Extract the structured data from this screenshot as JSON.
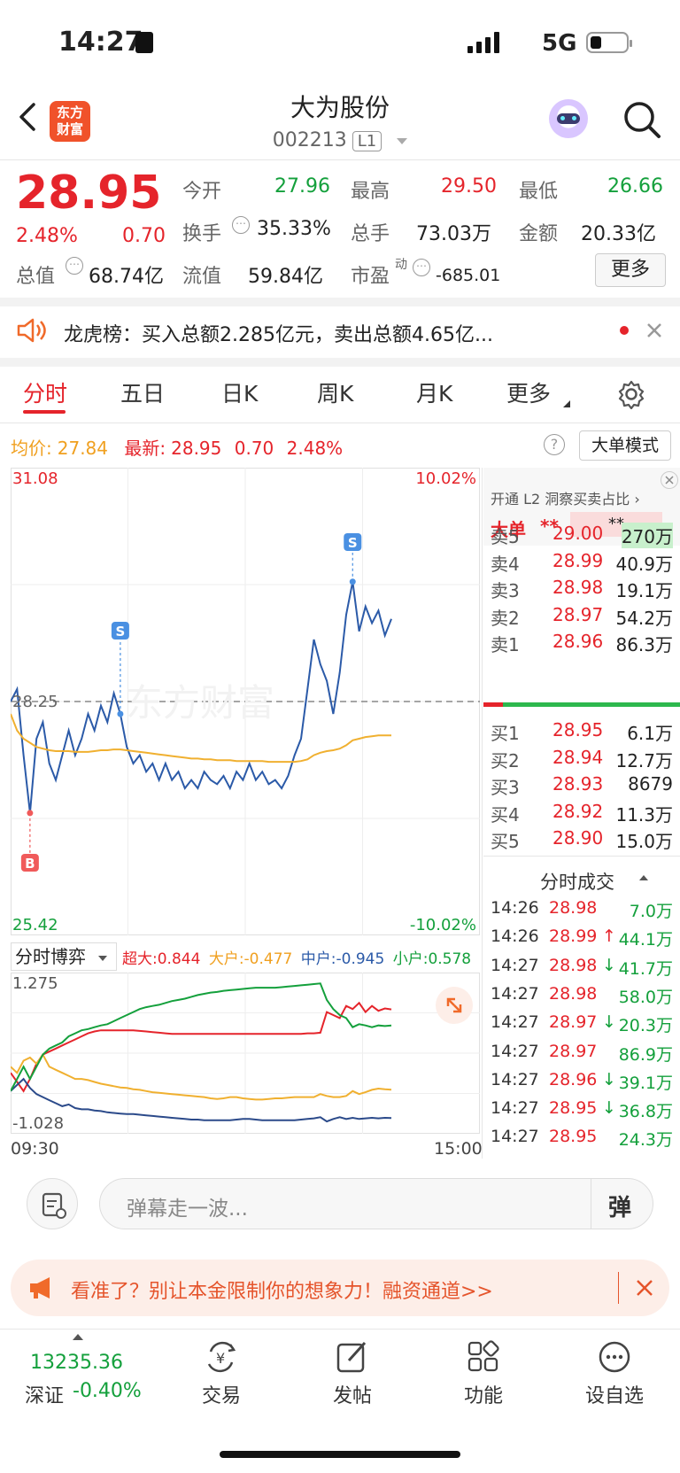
{
  "status_bar": {
    "time": "14:27",
    "network": "5G"
  },
  "header": {
    "title": "大为股份",
    "code": "002213",
    "level_badge": "L1",
    "logo_text_1": "东方",
    "logo_text_2": "财富"
  },
  "quote": {
    "price": "28.95",
    "change_pct": "2.48%",
    "change": "0.70",
    "open_label": "今开",
    "open": "27.96",
    "high_label": "最高",
    "high": "29.50",
    "low_label": "最低",
    "low": "26.66",
    "turnover_label": "换手",
    "turnover": "35.33%",
    "volume_label": "总手",
    "volume": "73.03万",
    "amount_label": "金额",
    "amount": "20.33亿",
    "mktcap_label": "总值",
    "mktcap": "68.74亿",
    "float_label": "流值",
    "float": "59.84亿",
    "pe_label": "市盈",
    "pe_sup": "动",
    "pe": "-685.01",
    "more_label": "更多"
  },
  "news": {
    "text": "龙虎榜：买入总额2.285亿元，卖出总额4.65亿..."
  },
  "tabs": [
    "分时",
    "五日",
    "日K",
    "周K",
    "月K",
    "更多"
  ],
  "chart_header": {
    "avg_label": "均价:",
    "avg": "27.84",
    "latest_label": "最新:",
    "latest": "28.95",
    "chg": "0.70",
    "chg_pct": "2.48%",
    "mode_button": "大单模式"
  },
  "chart_data": [
    {
      "type": "line",
      "name": "分时",
      "ylim": [
        25.42,
        31.08
      ],
      "y_tick_labels": [
        "31.08",
        "28.25",
        "25.42"
      ],
      "pct_tick_labels": [
        "10.02%",
        "-10.02%"
      ],
      "x_tick_labels": [
        "09:30",
        "15:00"
      ],
      "prev_close": 28.25,
      "series": [
        {
          "name": "price",
          "color": "#2b5aa8",
          "values": [
            28.25,
            28.4,
            27.6,
            26.9,
            27.8,
            28.0,
            27.5,
            27.3,
            27.6,
            27.9,
            27.6,
            27.8,
            28.1,
            27.9,
            28.2,
            28.0,
            28.35,
            28.1,
            27.7,
            27.5,
            27.6,
            27.4,
            27.5,
            27.3,
            27.5,
            27.3,
            27.4,
            27.2,
            27.3,
            27.2,
            27.4,
            27.3,
            27.25,
            27.35,
            27.2,
            27.4,
            27.3,
            27.5,
            27.3,
            27.4,
            27.25,
            27.3,
            27.2,
            27.35,
            27.6,
            27.8,
            28.4,
            29.0,
            28.7,
            28.5,
            28.1,
            28.6,
            29.3,
            29.7,
            29.1,
            29.4,
            29.2,
            29.35,
            29.05,
            29.25
          ]
        },
        {
          "name": "avg",
          "color": "#f0b030",
          "values": [
            28.1,
            27.9,
            27.8,
            27.75,
            27.7,
            27.68,
            27.66,
            27.65,
            27.65,
            27.65,
            27.64,
            27.64,
            27.64,
            27.65,
            27.66,
            27.66,
            27.67,
            27.67,
            27.66,
            27.65,
            27.64,
            27.63,
            27.62,
            27.61,
            27.6,
            27.59,
            27.58,
            27.57,
            27.56,
            27.56,
            27.55,
            27.55,
            27.54,
            27.54,
            27.54,
            27.53,
            27.53,
            27.53,
            27.53,
            27.53,
            27.52,
            27.52,
            27.52,
            27.52,
            27.52,
            27.53,
            27.55,
            27.6,
            27.63,
            27.65,
            27.66,
            27.68,
            27.72,
            27.78,
            27.8,
            27.82,
            27.83,
            27.84,
            27.84,
            27.84
          ]
        }
      ],
      "markers": [
        "B",
        "S",
        "S"
      ],
      "watermark": "东方财富"
    },
    {
      "type": "line",
      "name": "分时博弈",
      "ylim": [
        -1.028,
        1.275
      ],
      "y_tick_labels": [
        "1.275",
        "-1.028"
      ],
      "series": [
        {
          "name": "超大",
          "value_label": "0.844",
          "color": "#e5242b",
          "values": [
            -0.2,
            -0.35,
            -0.5,
            -0.3,
            -0.05,
            0.1,
            0.15,
            0.2,
            0.25,
            0.3,
            0.35,
            0.4,
            0.45,
            0.48,
            0.5,
            0.5,
            0.5,
            0.5,
            0.5,
            0.5,
            0.49,
            0.48,
            0.47,
            0.46,
            0.45,
            0.44,
            0.44,
            0.44,
            0.44,
            0.44,
            0.44,
            0.44,
            0.44,
            0.44,
            0.44,
            0.44,
            0.44,
            0.44,
            0.44,
            0.44,
            0.44,
            0.44,
            0.44,
            0.44,
            0.44,
            0.44,
            0.45,
            0.45,
            0.46,
            0.8,
            0.75,
            0.7,
            0.9,
            0.85,
            0.95,
            0.8,
            0.9,
            0.82,
            0.86,
            0.844
          ]
        },
        {
          "name": "大户",
          "value_label": "-0.477",
          "color": "#f0b030",
          "values": [
            -0.1,
            -0.2,
            0.0,
            0.05,
            -0.05,
            0.1,
            -0.1,
            -0.15,
            -0.2,
            -0.25,
            -0.3,
            -0.3,
            -0.32,
            -0.35,
            -0.38,
            -0.4,
            -0.42,
            -0.44,
            -0.45,
            -0.47,
            -0.48,
            -0.5,
            -0.52,
            -0.53,
            -0.54,
            -0.55,
            -0.56,
            -0.57,
            -0.58,
            -0.59,
            -0.6,
            -0.62,
            -0.63,
            -0.62,
            -0.6,
            -0.6,
            -0.62,
            -0.63,
            -0.64,
            -0.64,
            -0.63,
            -0.62,
            -0.62,
            -0.61,
            -0.6,
            -0.6,
            -0.6,
            -0.6,
            -0.55,
            -0.58,
            -0.6,
            -0.6,
            -0.58,
            -0.5,
            -0.55,
            -0.52,
            -0.48,
            -0.46,
            -0.47,
            -0.477
          ]
        },
        {
          "name": "中户",
          "value_label": "-0.945",
          "color": "#2b4a8a",
          "values": [
            -0.5,
            -0.4,
            -0.3,
            -0.45,
            -0.55,
            -0.6,
            -0.65,
            -0.7,
            -0.75,
            -0.72,
            -0.78,
            -0.8,
            -0.8,
            -0.82,
            -0.83,
            -0.85,
            -0.86,
            -0.87,
            -0.88,
            -0.88,
            -0.89,
            -0.9,
            -0.91,
            -0.92,
            -0.93,
            -0.94,
            -0.95,
            -0.96,
            -0.97,
            -0.97,
            -0.98,
            -0.98,
            -0.98,
            -0.98,
            -0.98,
            -0.97,
            -0.96,
            -0.96,
            -0.97,
            -0.98,
            -0.98,
            -0.98,
            -0.98,
            -0.98,
            -0.98,
            -0.97,
            -0.96,
            -0.95,
            -0.93,
            -1.0,
            -0.96,
            -0.93,
            -0.96,
            -0.94,
            -0.96,
            -0.95,
            -0.94,
            -0.95,
            -0.94,
            -0.945
          ]
        },
        {
          "name": "小户",
          "value_label": "0.578",
          "color": "#14a03c",
          "values": [
            -0.5,
            -0.3,
            -0.1,
            -0.3,
            -0.1,
            0.1,
            0.2,
            0.25,
            0.3,
            0.4,
            0.45,
            0.5,
            0.52,
            0.55,
            0.58,
            0.6,
            0.65,
            0.7,
            0.75,
            0.8,
            0.85,
            0.88,
            0.9,
            0.92,
            0.95,
            0.98,
            1.0,
            1.02,
            1.05,
            1.08,
            1.1,
            1.12,
            1.13,
            1.15,
            1.16,
            1.17,
            1.18,
            1.19,
            1.2,
            1.2,
            1.2,
            1.2,
            1.21,
            1.22,
            1.23,
            1.24,
            1.25,
            1.26,
            1.27,
            1.0,
            0.85,
            0.75,
            0.7,
            0.55,
            0.6,
            0.58,
            0.55,
            0.58,
            0.57,
            0.578
          ]
        }
      ]
    }
  ],
  "game_header": {
    "title": "分时博弈"
  },
  "order_book": {
    "promo": "开通 L2 洞察买卖占比",
    "big_label": "大单",
    "big_val1": "**",
    "big_val2": "**",
    "asks": [
      {
        "label": "卖5",
        "price": "29.00",
        "vol": "270万"
      },
      {
        "label": "卖4",
        "price": "28.99",
        "vol": "40.9万"
      },
      {
        "label": "卖3",
        "price": "28.98",
        "vol": "19.1万"
      },
      {
        "label": "卖2",
        "price": "28.97",
        "vol": "54.2万"
      },
      {
        "label": "卖1",
        "price": "28.96",
        "vol": "86.3万"
      }
    ],
    "bids": [
      {
        "label": "买1",
        "price": "28.95",
        "vol": "6.1万"
      },
      {
        "label": "买2",
        "price": "28.94",
        "vol": "12.7万"
      },
      {
        "label": "买3",
        "price": "28.93",
        "vol": "8679"
      },
      {
        "label": "买4",
        "price": "28.92",
        "vol": "11.3万"
      },
      {
        "label": "买5",
        "price": "28.90",
        "vol": "15.0万"
      }
    ],
    "trades_title": "分时成交",
    "trades": [
      {
        "time": "14:26",
        "price": "28.98",
        "vol": "7.0万",
        "dir": ""
      },
      {
        "time": "14:26",
        "price": "28.99",
        "vol": "44.1万",
        "dir": "↑"
      },
      {
        "time": "14:27",
        "price": "28.98",
        "vol": "41.7万",
        "dir": "↓"
      },
      {
        "time": "14:27",
        "price": "28.98",
        "vol": "58.0万",
        "dir": ""
      },
      {
        "time": "14:27",
        "price": "28.97",
        "vol": "20.3万",
        "dir": "↓"
      },
      {
        "time": "14:27",
        "price": "28.97",
        "vol": "86.9万",
        "dir": ""
      },
      {
        "time": "14:27",
        "price": "28.96",
        "vol": "39.1万",
        "dir": "↓"
      },
      {
        "time": "14:27",
        "price": "28.95",
        "vol": "36.8万",
        "dir": "↓"
      },
      {
        "time": "14:27",
        "price": "28.95",
        "vol": "24.3万",
        "dir": ""
      }
    ]
  },
  "danmu": {
    "placeholder": "弹幕走一波...",
    "button": "弹"
  },
  "ad": {
    "text": "看准了？别让本金限制你的想象力！融资通道>>"
  },
  "bottom_nav": {
    "index_value": "13235.36",
    "index_name": "深证",
    "index_chg": "-0.40%",
    "items": [
      "交易",
      "发帖",
      "功能",
      "设自选"
    ]
  }
}
